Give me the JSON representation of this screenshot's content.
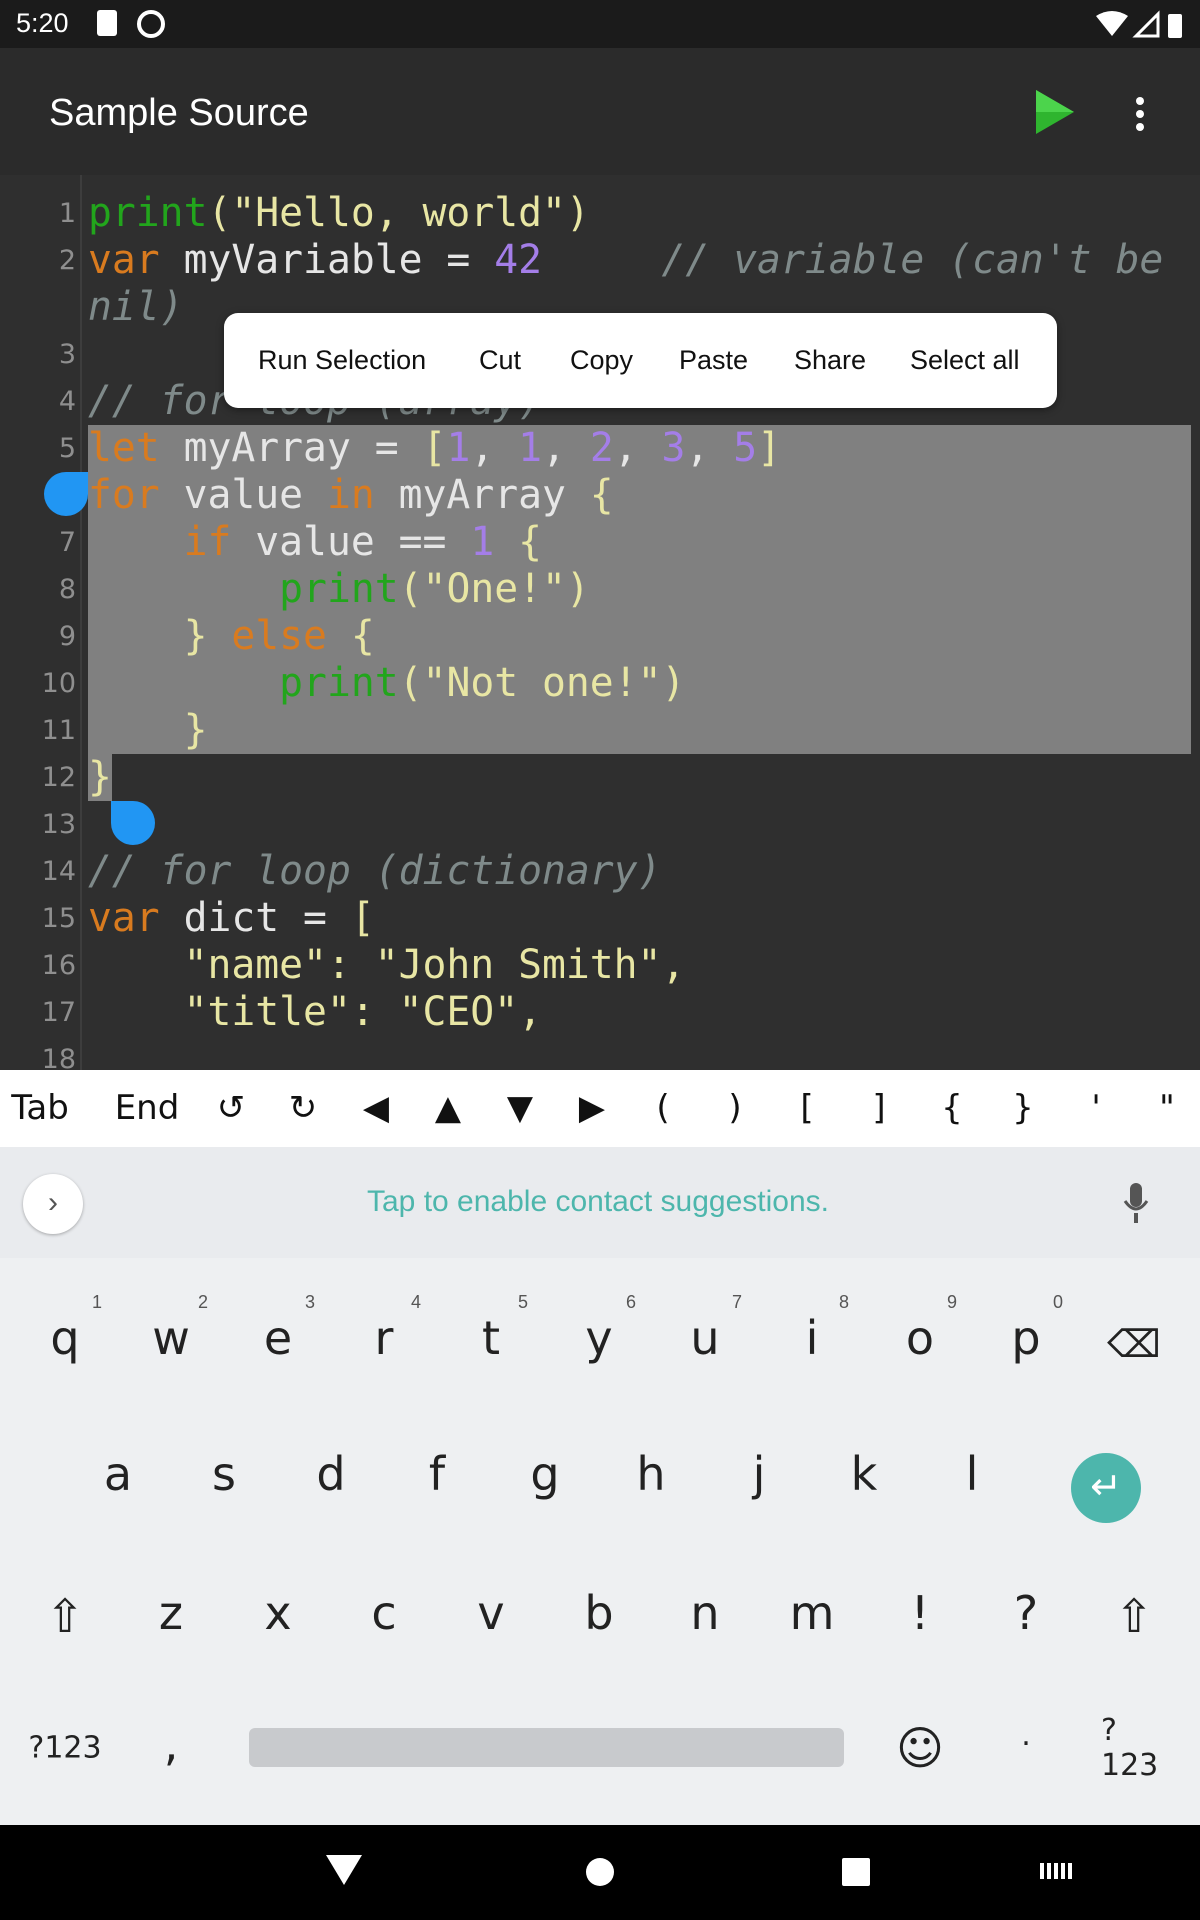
{
  "status": {
    "time": "5:20"
  },
  "appbar": {
    "title": "Sample Source",
    "run_icon": "play-icon",
    "menu_icon": "more-vert-icon"
  },
  "colors": {
    "accent": "#2196f3",
    "keyword": "#d97b1f",
    "function": "#22a51c",
    "string": "#e8e6a4",
    "number": "#a47ee8",
    "comment": "#7f8a8a",
    "selection": "#808080",
    "enter_key": "#4db6ac"
  },
  "editor": {
    "rows": [
      {
        "num": "1",
        "tokens": [
          {
            "t": "print",
            "c": "fn"
          },
          {
            "t": "(",
            "c": "pn"
          },
          {
            "t": "\"Hello, world\"",
            "c": "st"
          },
          {
            "t": ")",
            "c": "pn"
          }
        ]
      },
      {
        "num": "2",
        "tokens": [
          {
            "t": "var",
            "c": "kw"
          },
          {
            "t": " myVariable = ",
            "c": "pl"
          },
          {
            "t": "42",
            "c": "nm"
          },
          {
            "t": "     // variable (can't be",
            "c": "cm"
          }
        ]
      },
      {
        "num": "",
        "tokens": [
          {
            "t": "nil)",
            "c": "cm"
          }
        ]
      },
      {
        "num": "3",
        "tokens": []
      },
      {
        "num": "4",
        "tokens": [
          {
            "t": "// for loop (array)",
            "c": "cm"
          }
        ]
      },
      {
        "num": "5",
        "tokens": [
          {
            "t": "let",
            "c": "kw"
          },
          {
            "t": " myArray = ",
            "c": "pl"
          },
          {
            "t": "[",
            "c": "pn"
          },
          {
            "t": "1",
            "c": "nm"
          },
          {
            "t": ", ",
            "c": "pl"
          },
          {
            "t": "1",
            "c": "nm"
          },
          {
            "t": ", ",
            "c": "pl"
          },
          {
            "t": "2",
            "c": "nm"
          },
          {
            "t": ", ",
            "c": "pl"
          },
          {
            "t": "3",
            "c": "nm"
          },
          {
            "t": ", ",
            "c": "pl"
          },
          {
            "t": "5",
            "c": "nm"
          },
          {
            "t": "]",
            "c": "pn"
          }
        ]
      },
      {
        "num": "6",
        "tokens": [
          {
            "t": "for",
            "c": "kw"
          },
          {
            "t": " value ",
            "c": "pl"
          },
          {
            "t": "in",
            "c": "kw"
          },
          {
            "t": " myArray ",
            "c": "pl"
          },
          {
            "t": "{",
            "c": "pn"
          }
        ]
      },
      {
        "num": "7",
        "tokens": [
          {
            "t": "    ",
            "c": "pl"
          },
          {
            "t": "if",
            "c": "kw"
          },
          {
            "t": " value == ",
            "c": "pl"
          },
          {
            "t": "1",
            "c": "nm"
          },
          {
            "t": " {",
            "c": "pn"
          }
        ]
      },
      {
        "num": "8",
        "tokens": [
          {
            "t": "        ",
            "c": "pl"
          },
          {
            "t": "print",
            "c": "fn"
          },
          {
            "t": "(",
            "c": "pn"
          },
          {
            "t": "\"One!\"",
            "c": "st"
          },
          {
            "t": ")",
            "c": "pn"
          }
        ]
      },
      {
        "num": "9",
        "tokens": [
          {
            "t": "    } ",
            "c": "pn"
          },
          {
            "t": "else",
            "c": "kw"
          },
          {
            "t": " {",
            "c": "pn"
          }
        ]
      },
      {
        "num": "10",
        "tokens": [
          {
            "t": "        ",
            "c": "pl"
          },
          {
            "t": "print",
            "c": "fn"
          },
          {
            "t": "(",
            "c": "pn"
          },
          {
            "t": "\"Not one!\"",
            "c": "st"
          },
          {
            "t": ")",
            "c": "pn"
          }
        ]
      },
      {
        "num": "11",
        "tokens": [
          {
            "t": "    }",
            "c": "pn"
          }
        ]
      },
      {
        "num": "12",
        "tokens": [
          {
            "t": "}",
            "c": "pn"
          }
        ]
      },
      {
        "num": "13",
        "tokens": []
      },
      {
        "num": "14",
        "tokens": [
          {
            "t": "// for loop (dictionary)",
            "c": "cm"
          }
        ]
      },
      {
        "num": "15",
        "tokens": [
          {
            "t": "var",
            "c": "kw"
          },
          {
            "t": " dict = ",
            "c": "pl"
          },
          {
            "t": "[",
            "c": "pn"
          }
        ]
      },
      {
        "num": "16",
        "tokens": [
          {
            "t": "    \"name\": \"John Smith\",",
            "c": "st"
          }
        ]
      },
      {
        "num": "17",
        "tokens": [
          {
            "t": "    \"title\": \"CEO\",",
            "c": "st"
          }
        ]
      },
      {
        "num": "18",
        "tokens": []
      }
    ]
  },
  "context_menu": [
    "Run Selection",
    "Cut",
    "Copy",
    "Paste",
    "Share",
    "Select all"
  ],
  "extra_keys": [
    "Tab",
    "End",
    "↺",
    "↻",
    "◀",
    "▲",
    "▼",
    "▶",
    "(",
    ")",
    "[",
    "]",
    "{",
    "}",
    "'",
    "\""
  ],
  "suggestions": {
    "text": "Tap to enable contact suggestions."
  },
  "keyboard": {
    "row1": [
      "q",
      "w",
      "e",
      "r",
      "t",
      "y",
      "u",
      "i",
      "o",
      "p"
    ],
    "row1_hints": [
      "1",
      "2",
      "3",
      "4",
      "5",
      "6",
      "7",
      "8",
      "9",
      "0"
    ],
    "row2": [
      "a",
      "s",
      "d",
      "f",
      "g",
      "h",
      "j",
      "k",
      "l"
    ],
    "row3": [
      "z",
      "x",
      "c",
      "v",
      "b",
      "n",
      "m",
      "!",
      "?"
    ],
    "symbols_label": "?123",
    "comma": ",",
    "period": "·"
  }
}
